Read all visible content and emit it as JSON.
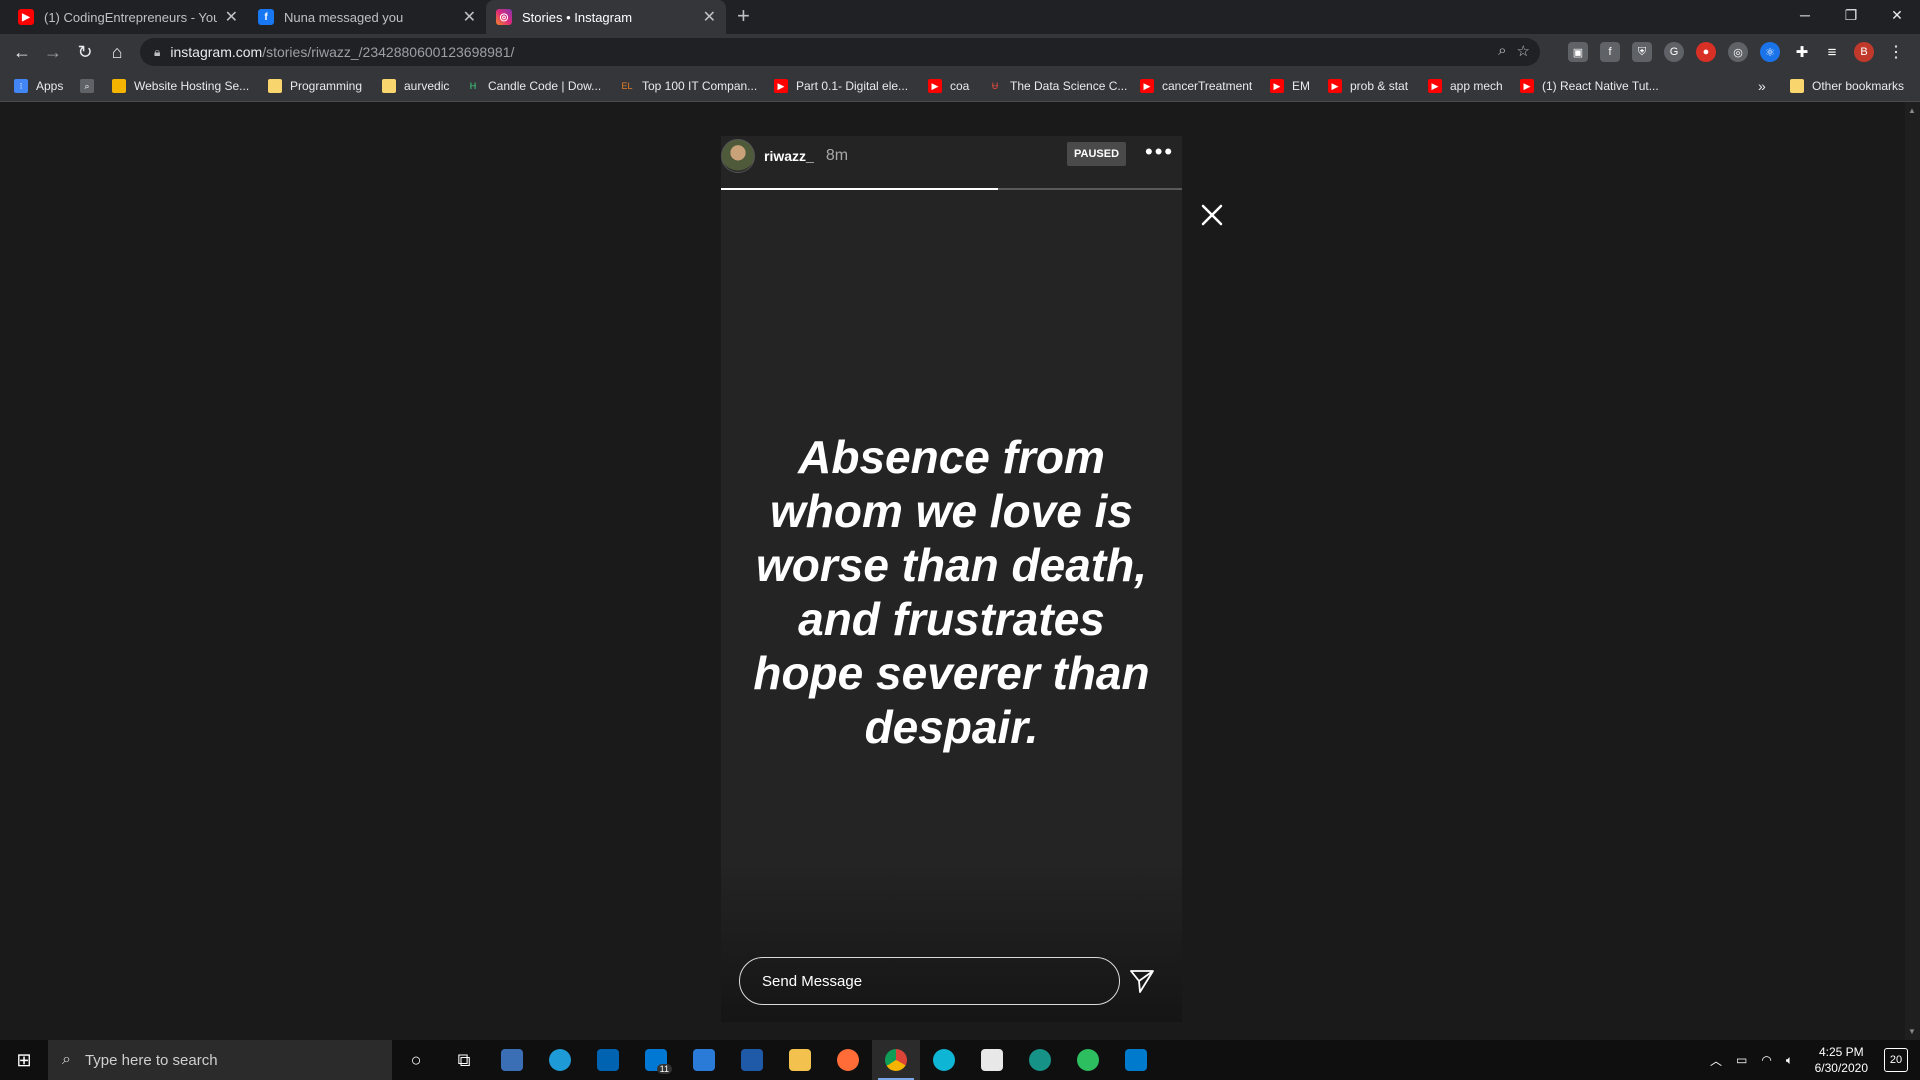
{
  "browser": {
    "tabs": [
      {
        "title": "(1) CodingEntrepreneurs - YouTu",
        "favicon_color": "#ff0000"
      },
      {
        "title": "Nuna messaged you",
        "favicon_color": "#1877f2"
      },
      {
        "title": "Stories • Instagram",
        "favicon_color": "#e1306c"
      }
    ],
    "url_host": "instagram.com",
    "url_path": "/stories/riwazz_/2342880600123698981/",
    "bookmarks": [
      {
        "label": "Apps",
        "icon": "apps-grid-icon",
        "color": "#4285f4"
      },
      {
        "label": "",
        "icon": "search-bookmark-icon",
        "color": "#5f6368"
      },
      {
        "label": "Website Hosting Se...",
        "icon": "hosting-icon",
        "color": "#f4b400"
      },
      {
        "label": "Programming",
        "icon": "folder-icon",
        "color": "#f9d56e"
      },
      {
        "label": "aurvedic",
        "icon": "folder-icon",
        "color": "#f9d56e"
      },
      {
        "label": "Candle Code | Dow...",
        "icon": "h-icon",
        "color": "#3ddc84"
      },
      {
        "label": "Top 100 IT Compan...",
        "icon": "el-icon",
        "color": "#e67e22"
      },
      {
        "label": "Part 0.1- Digital ele...",
        "icon": "youtube-icon",
        "color": "#ff0000"
      },
      {
        "label": "coa",
        "icon": "youtube-icon",
        "color": "#ff0000"
      },
      {
        "label": "The Data Science C...",
        "icon": "ds-icon",
        "color": "#e74c3c"
      },
      {
        "label": "cancerTreatment",
        "icon": "youtube-icon",
        "color": "#ff0000"
      },
      {
        "label": "EM",
        "icon": "youtube-icon",
        "color": "#ff0000"
      },
      {
        "label": "prob & stat",
        "icon": "youtube-icon",
        "color": "#ff0000"
      },
      {
        "label": "app mech",
        "icon": "youtube-icon",
        "color": "#ff0000"
      },
      {
        "label": "(1) React Native Tut...",
        "icon": "youtube-icon",
        "color": "#ff0000"
      }
    ],
    "bookmarks_overflow": "»",
    "other_bookmarks": "Other bookmarks",
    "profile_initial": "B"
  },
  "story": {
    "username": "riwazz_",
    "time_ago": "8m",
    "status_badge": "PAUSED",
    "more_label": "•••",
    "progress": 0.6,
    "quote": "Absence from whom we love is worse than death, and frustrates hope severer than despair.",
    "message_placeholder": "Send Message"
  },
  "taskbar": {
    "search_placeholder": "Type here to search",
    "mail_badge": "11",
    "time": "4:25 PM",
    "date": "6/30/2020",
    "notifications": "20"
  }
}
